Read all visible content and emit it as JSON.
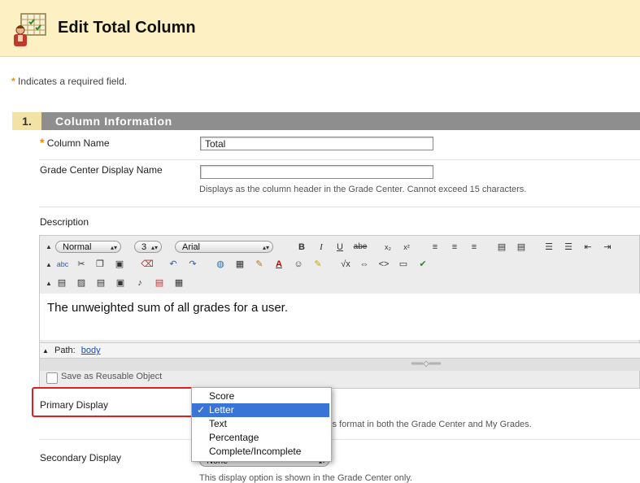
{
  "header": {
    "title": "Edit Total Column",
    "icon": "gradebook-teacher-icon"
  },
  "required_note": {
    "star": "*",
    "text": "Indicates a required field."
  },
  "section": {
    "number": "1.",
    "title": "Column Information"
  },
  "fields": {
    "column_name": {
      "star": "*",
      "label": "Column Name",
      "value": "Total"
    },
    "display_name": {
      "label": "Grade Center Display Name",
      "value": "",
      "hint": "Displays as the column header in the Grade Center. Cannot exceed 15 characters."
    },
    "description": {
      "label": "Description"
    }
  },
  "editor": {
    "format": "Normal",
    "size": "3",
    "font": "Arial",
    "content": "The unweighted sum of all grades for a user.",
    "path_label": "Path:",
    "path_value": "body",
    "save_reusable": "Save as Reusable Object"
  },
  "primary_display": {
    "label": "Primary Display",
    "hint_tail": "his format in both the Grade Center and My Grades.",
    "options": [
      "Score",
      "Letter",
      "Text",
      "Percentage",
      "Complete/Incomplete"
    ],
    "selected": "Letter",
    "check": "✓"
  },
  "secondary_display": {
    "label": "Secondary Display",
    "value": "None",
    "hint": "This display option is shown in the Grade Center only."
  }
}
